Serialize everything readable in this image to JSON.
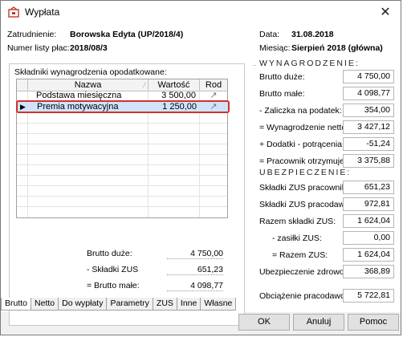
{
  "window": {
    "title": "Wypłata",
    "close": "✕"
  },
  "header": {
    "employment_label": "Zatrudnienie:",
    "employment_value": "Borowska Edyta (UP/2018/4)",
    "payroll_label": "Numer listy płac:",
    "payroll_value": "2018/08/3",
    "date_label": "Data:",
    "date_value": "31.08.2018",
    "month_label": "Miesiąc:",
    "month_value": "Sierpień 2018 (główna)"
  },
  "components": {
    "title": "Składniki wynagrodzenia opodatkowane:",
    "columns": [
      "Nazwa",
      "Wartość",
      "Rod"
    ],
    "rows": [
      {
        "name": "Podstawa miesięczna",
        "value": "3 500,00",
        "rod": "↗"
      },
      {
        "name": "Premia motywacyjna",
        "value": "1 250,00",
        "rod": "↗"
      }
    ],
    "summary": [
      {
        "label": "Brutto duże:",
        "value": "4 750,00"
      },
      {
        "label": "- Składki ZUS",
        "value": "651,23"
      },
      {
        "label": "= Brutto małe:",
        "value": "4 098,77"
      }
    ]
  },
  "wages": {
    "title": "WYNAGRODZENIE:",
    "items": [
      {
        "label": "Brutto duże:",
        "value": "4 750,00"
      },
      {
        "label": "Brutto małe:",
        "value": "4 098,77"
      },
      {
        "label": "- Zaliczka na podatek:",
        "value": "354,00"
      },
      {
        "label": "= Wynagrodzenie netto:",
        "value": "3 427,12"
      },
      {
        "label": "+ Dodatki - potrącenia:",
        "value": "-51,24"
      },
      {
        "label": "= Pracownik otrzymuje:",
        "value": "3 375,88"
      }
    ]
  },
  "insurance": {
    "title": "UBEZPIECZENIE:",
    "items": [
      {
        "label": "Składki ZUS pracownika:",
        "value": "651,23"
      },
      {
        "label": "Składki ZUS pracodawcy:",
        "value": "972,81"
      },
      {
        "label": "Razem składki ZUS:",
        "value": "1 624,04"
      },
      {
        "label": "- zasiłki ZUS:",
        "value": "0,00"
      },
      {
        "label": "= Razem ZUS:",
        "value": "1 624,04"
      },
      {
        "label": "Ubezpieczenie zdrowotne:",
        "value": "368,89"
      }
    ],
    "employer_load_label": "Obciążenie pracodawcy:",
    "employer_load_value": "5 722,81"
  },
  "tabs": [
    "Brutto",
    "Netto",
    "Do wypłaty",
    "Parametry",
    "ZUS",
    "Inne",
    "Własne"
  ],
  "buttons": {
    "ok": "OK",
    "cancel": "Anuluj",
    "help": "Pomoc"
  }
}
